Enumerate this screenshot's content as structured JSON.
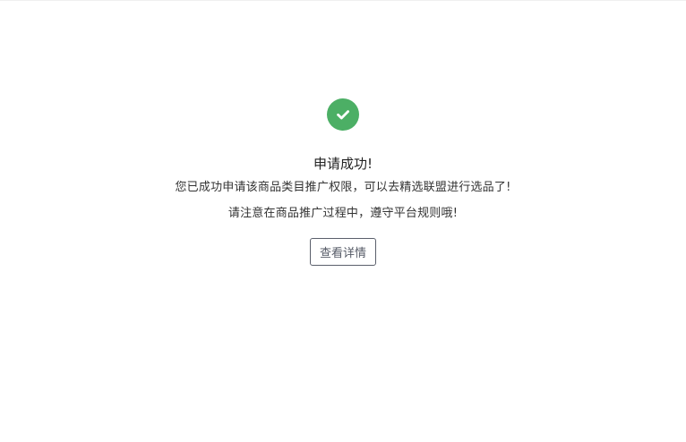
{
  "result": {
    "status_icon": "check-circle-icon",
    "status_color": "#4caf65",
    "title": "申请成功!",
    "message_line1": "您已成功申请该商品类目推广权限，可以去精选联盟进行选品了!",
    "message_line2": "请注意在商品推广过程中，遵守平台规则哦!",
    "detail_button_label": "查看详情"
  }
}
